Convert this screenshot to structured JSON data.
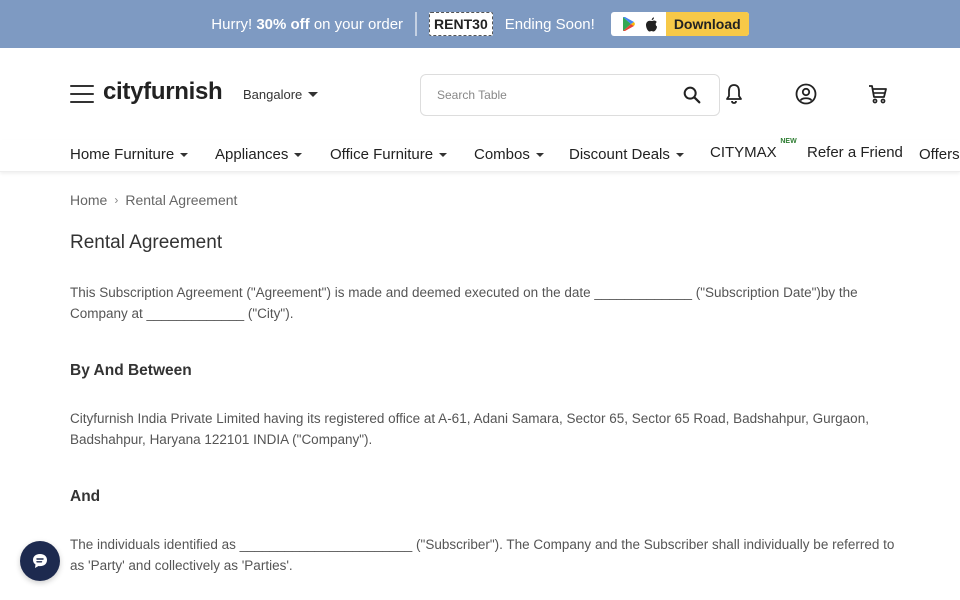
{
  "promo": {
    "lead": "Hurry!",
    "discount": "30% off",
    "tail": "on your order",
    "coupon": "RENT30",
    "ending": "Ending Soon!",
    "download_label": "Download"
  },
  "header": {
    "logo": "cityfurnish",
    "city": "Bangalore",
    "search_placeholder": "Search Table"
  },
  "nav": {
    "items": [
      {
        "label": "Home Furniture"
      },
      {
        "label": "Appliances"
      },
      {
        "label": "Office Furniture"
      },
      {
        "label": "Combos"
      },
      {
        "label": "Discount Deals"
      },
      {
        "label": "CITYMAX",
        "badge": "NEW"
      },
      {
        "label": "Refer a Friend"
      },
      {
        "label": "Offers"
      }
    ]
  },
  "breadcrumb": {
    "home": "Home",
    "current": "Rental Agreement"
  },
  "page": {
    "title": "Rental Agreement",
    "intro": "This Subscription Agreement (\"Agreement\") is made and deemed executed on the date _____________ (\"Subscription Date\")by the Company at _____________ (\"City\").",
    "heading_between": "By And Between",
    "company_para": "Cityfurnish India Private Limited having its registered office at A-61, Adani Samara, Sector 65, Sector 65 Road, Badshahpur, Gurgaon, Badshahpur, Haryana 122101 INDIA (\"Company\").",
    "heading_and": "And",
    "subscriber_para": "The individuals identified as _______________________ (\"Subscriber\"). The Company and the Subscriber shall individually be referred to as 'Party' and collectively as 'Parties'."
  },
  "colors": {
    "promo_bg": "#7e9ac2",
    "download_bg": "#f7c948",
    "chat_bg": "#1d2a4f"
  }
}
